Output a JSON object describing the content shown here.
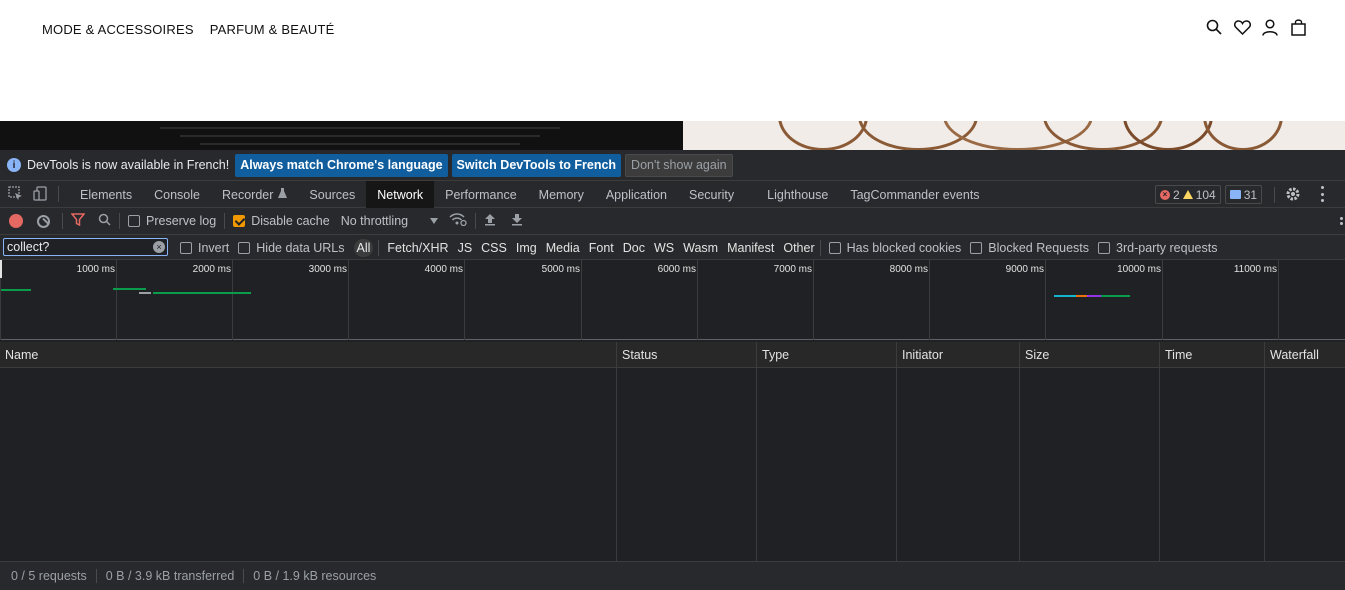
{
  "site": {
    "nav": [
      "MODE & ACCESSOIRES",
      "PARFUM & BEAUTÉ"
    ],
    "icons": [
      "search-icon",
      "heart-icon",
      "user-icon",
      "bag-icon"
    ]
  },
  "infobar": {
    "message": "DevTools is now available in French!",
    "btn_match": "Always match Chrome's language",
    "btn_switch": "Switch DevTools to French",
    "btn_dismiss": "Don't show again"
  },
  "tabs": [
    "Elements",
    "Console",
    "Recorder",
    "Sources",
    "Network",
    "Performance",
    "Memory",
    "Application",
    "Security",
    "Lighthouse",
    "TagCommander events"
  ],
  "active_tab": "Network",
  "counts": {
    "errors": "2",
    "warnings": "104",
    "messages": "31"
  },
  "toolbar": {
    "preserve_log": "Preserve log",
    "disable_cache": "Disable cache",
    "throttling": "No throttling"
  },
  "filter": {
    "value": "collect?",
    "invert": "Invert",
    "hide_data_urls": "Hide data URLs",
    "types": [
      "All",
      "Fetch/XHR",
      "JS",
      "CSS",
      "Img",
      "Media",
      "Font",
      "Doc",
      "WS",
      "Wasm",
      "Manifest",
      "Other"
    ],
    "selected_type": "All",
    "has_blocked_cookies": "Has blocked cookies",
    "blocked_requests": "Blocked Requests",
    "third_party": "3rd-party requests"
  },
  "overview": {
    "ticks": [
      "1000 ms",
      "2000 ms",
      "3000 ms",
      "4000 ms",
      "5000 ms",
      "6000 ms",
      "7000 ms",
      "8000 ms",
      "9000 ms",
      "10000 ms",
      "11000 ms"
    ],
    "colors": {
      "green": "#0a9c4a",
      "orange": "#e8710a",
      "purple": "#9334e6",
      "teal": "#12b5cb"
    }
  },
  "columns": [
    "Name",
    "Status",
    "Type",
    "Initiator",
    "Size",
    "Time",
    "Waterfall"
  ],
  "status": {
    "requests": "0 / 5 requests",
    "transferred": "0 B / 3.9 kB transferred",
    "resources": "0 B / 1.9 kB resources"
  }
}
